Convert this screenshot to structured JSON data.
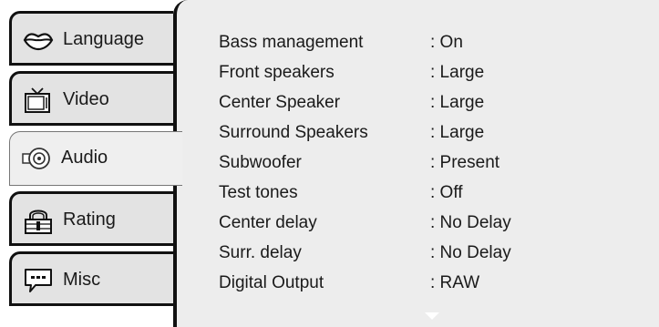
{
  "tabs": [
    {
      "label": "Language",
      "icon": "lips-icon"
    },
    {
      "label": "Video",
      "icon": "tv-icon"
    },
    {
      "label": "Audio",
      "icon": "speaker-icon"
    },
    {
      "label": "Rating",
      "icon": "padlock-icon"
    },
    {
      "label": "Misc",
      "icon": "speech-bubble-icon"
    }
  ],
  "active_tab": "Audio",
  "settings": [
    {
      "label": "Bass management",
      "value": ": On"
    },
    {
      "label": "Front speakers",
      "value": ": Large"
    },
    {
      "label": "Center Speaker",
      "value": ": Large"
    },
    {
      "label": "Surround Speakers",
      "value": ": Large"
    },
    {
      "label": "Subwoofer",
      "value": ": Present"
    },
    {
      "label": "Test tones",
      "value": ": Off"
    },
    {
      "label": "Center delay",
      "value": ": No Delay"
    },
    {
      "label": "Surr. delay",
      "value": ": No Delay"
    },
    {
      "label": "Digital Output",
      "value": ": RAW"
    }
  ],
  "scroll_indicator": "chevron-down-icon"
}
